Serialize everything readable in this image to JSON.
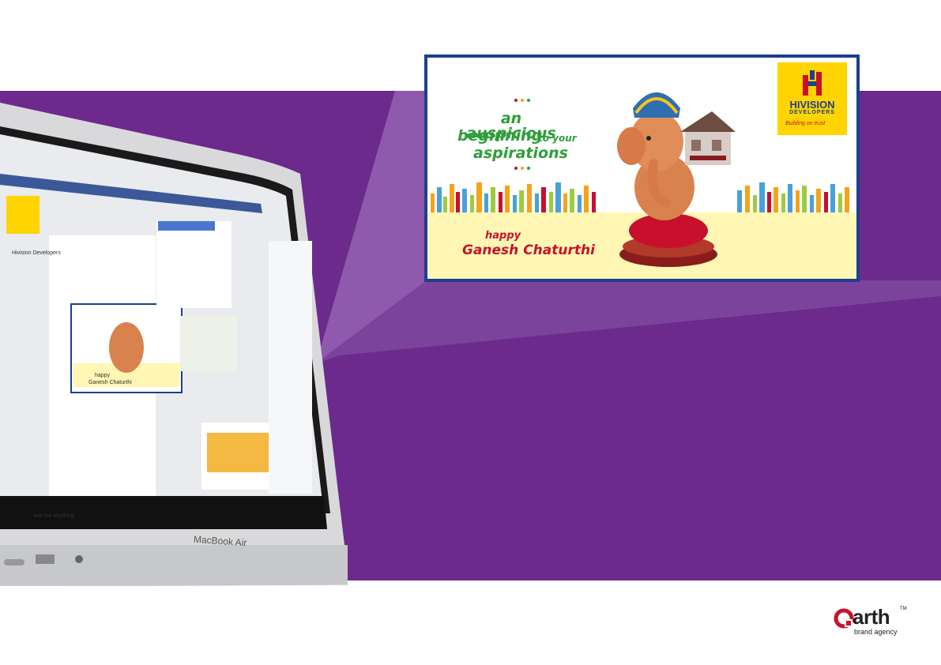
{
  "creative": {
    "tagline_line1": "an auspicious",
    "tagline_line2_a": "beginning",
    "tagline_line2_b": "to your",
    "tagline_line3": "aspirations",
    "greeting": "happy",
    "festival": "Ganesh Chaturthi"
  },
  "brand_logo": {
    "name": "HIVISION",
    "sub": "DEVELOPERS",
    "tagline": "Building on trust"
  },
  "agency": {
    "name": "arth",
    "tm": "TM",
    "sub": "brand agency"
  },
  "laptop": {
    "model": "MacBook Air",
    "page_title": "Hivision Developers",
    "search_placeholder": "Ask me anything",
    "post_greeting": "happy",
    "post_festival": "Ganesh Chaturthi"
  },
  "colors": {
    "purple": "#6c2a8c",
    "creative_border": "#1d3f8f",
    "tagline_green": "#2e9e3a",
    "festival_red": "#c8102e",
    "logo_yellow": "#ffd400"
  }
}
